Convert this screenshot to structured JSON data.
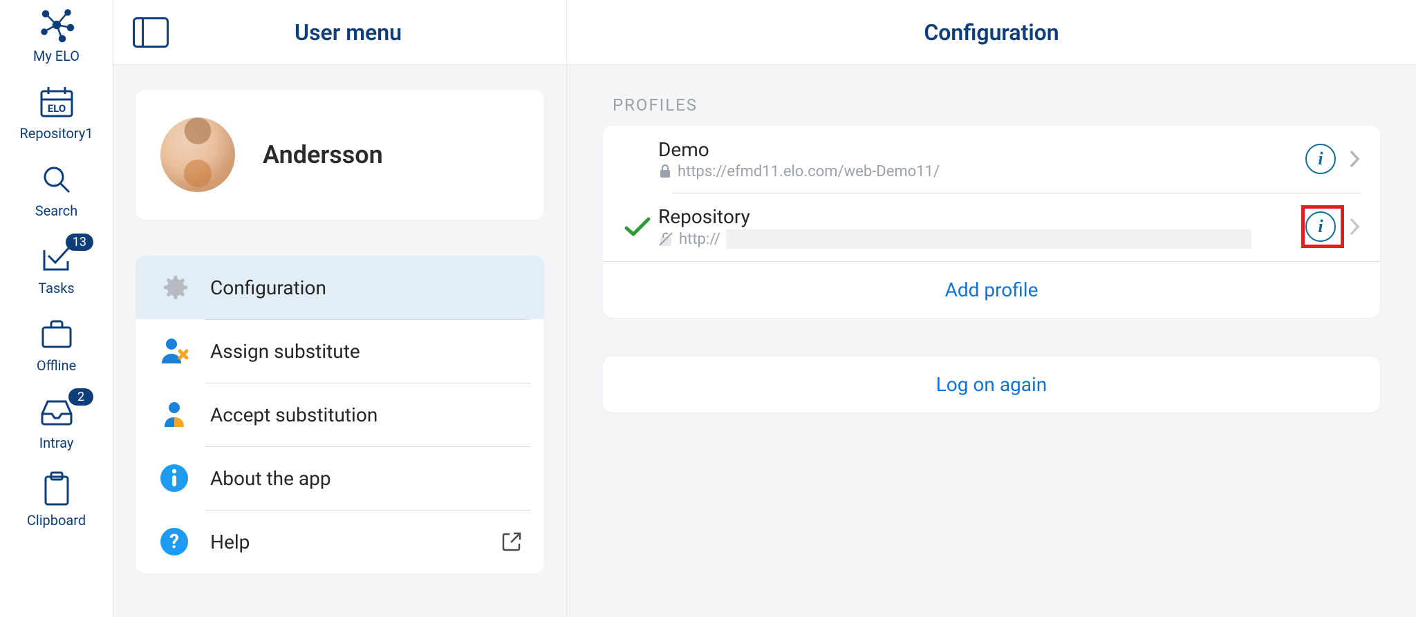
{
  "rail": {
    "items": [
      {
        "key": "my-elo",
        "label": "My ELO"
      },
      {
        "key": "repository",
        "label": "Repository1"
      },
      {
        "key": "search",
        "label": "Search"
      },
      {
        "key": "tasks",
        "label": "Tasks",
        "badge": "13"
      },
      {
        "key": "offline",
        "label": "Offline"
      },
      {
        "key": "intray",
        "label": "Intray",
        "badge": "2"
      },
      {
        "key": "clipboard",
        "label": "Clipboard"
      }
    ]
  },
  "mid": {
    "title": "User menu",
    "user_name": "Andersson",
    "menu": [
      {
        "key": "configuration",
        "label": "Configuration",
        "selected": true
      },
      {
        "key": "assign-substitute",
        "label": "Assign substitute"
      },
      {
        "key": "accept-substitution",
        "label": "Accept substitution"
      },
      {
        "key": "about",
        "label": "About the app"
      },
      {
        "key": "help",
        "label": "Help",
        "trailing": "external"
      }
    ]
  },
  "right": {
    "title": "Configuration",
    "section_label": "PROFILES",
    "profiles": [
      {
        "name": "Demo",
        "url": "https://efmd11.elo.com/web-Demo11/",
        "secure": true,
        "active": false,
        "info_highlighted": false
      },
      {
        "name": "Repository",
        "url": "http://",
        "secure": false,
        "active": true,
        "info_highlighted": true,
        "url_redacted": true
      }
    ],
    "add_profile_label": "Add profile",
    "log_on_again_label": "Log on again"
  },
  "colors": {
    "brand": "#0e3e7a",
    "link": "#1073d6",
    "highlight": "#e02020",
    "success": "#2e9b3a"
  }
}
